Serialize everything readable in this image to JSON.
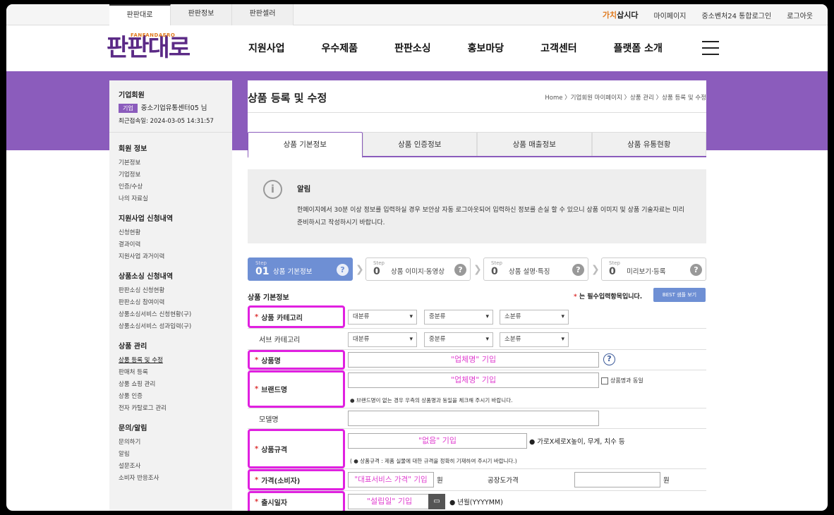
{
  "top_tabs": [
    "판판대로",
    "판판정보",
    "판판셀러"
  ],
  "top_links": {
    "gachi_a": "가치",
    "gachi_b": "삽시다",
    "mypage": "마이페이지",
    "sso": "중소벤처24 통합로그인",
    "logout": "로그아웃"
  },
  "logo": {
    "sub": "FANFANDAERO",
    "main": "판판대로"
  },
  "gnb": [
    "지원사업",
    "우수제품",
    "판판소싱",
    "홍보마당",
    "고객센터",
    "플랫폼 소개"
  ],
  "sidebar": {
    "member_title": "기업회원",
    "badge": "기업",
    "company": "중소기업유통센터05 님",
    "last_login": "최근접속일: 2024-03-05 14:31:57",
    "sections": [
      {
        "title": "회원 정보",
        "items": [
          "기본정보",
          "기업정보",
          "인증/수상",
          "나의 자료실"
        ]
      },
      {
        "title": "지원사업 신청내역",
        "items": [
          "신청현황",
          "결과이력",
          "지원사업 과거이력"
        ]
      },
      {
        "title": "상품소싱 신청내역",
        "items": [
          "판판소싱 신청현황",
          "판판소싱 참여이력",
          "상품소싱서비스 신청현황(구)",
          "상품소싱서비스 성과입력(구)"
        ]
      },
      {
        "title": "상품 관리",
        "items": [
          "상품 등록 및 수정",
          "판매처 등록",
          "상품 쇼핑 관리",
          "상품 인증",
          "전자 카탈로그 관리"
        ]
      },
      {
        "title": "문의/알림",
        "items": [
          "문의하기",
          "알림",
          "설문조사",
          "소비자 반응조사"
        ]
      }
    ]
  },
  "page": {
    "title": "상품 등록 및 수정",
    "breadcrumb": "Home 〉기업회원 마이페이지 〉상품 관리 〉상품 등록 및 수정"
  },
  "tabs": [
    "상품 기본정보",
    "상품 인증정보",
    "상품 매출정보",
    "상품 유통현황"
  ],
  "notice": {
    "title": "알림",
    "body": "한페이지에서 30분 이상 정보를 입력하실 경우 보안상 자동 로그아웃되어 입력하신 정보를 손실 할 수 있으니 상품 이미지 및 상품 기술자료는 미리 준비하시고 작성하시기 바랍니다."
  },
  "steps": [
    {
      "tag": "Step",
      "num": "01",
      "label": "상품 기본정보"
    },
    {
      "tag": "Step",
      "num": "0",
      "label": "상품 이미지·동영상"
    },
    {
      "tag": "Step",
      "num": "0",
      "label": "상품 설명·특징"
    },
    {
      "tag": "Step",
      "num": "0",
      "label": "미리보기·등록"
    }
  ],
  "form": {
    "section_title": "상품 기본정보",
    "required_mark": "*",
    "required_text": " 는 필수입력항목입니다.",
    "best_button": "BEST 샘플 보기",
    "category_label": "상품 카테고리",
    "sub_category_label": "서브 카테고리",
    "selects": [
      "대분류",
      "중분류",
      "소분류"
    ],
    "product_name_label": "상품명",
    "product_name_value": "\"업체명\" 기입",
    "brand_label": "브랜드명",
    "brand_value": "\"업체명\" 기입",
    "brand_same": "상품명과 동일",
    "brand_note": "● 브랜드명이 없는 경우 우측의 상품명과 동일을 체크해 주시기 바랍니다.",
    "model_label": "모델명",
    "spec_label": "상품규격",
    "spec_value": "\"없음\" 기입",
    "spec_hint": "● 가로X세로X높이, 무게, 치수 등",
    "spec_note": "( ● 상품규격 : 제품 실물에 대한 규격을 정확히 기재하여 주시기 바랍니다.)",
    "price_label": "가격(소비자)",
    "price_value": "\"대표서비스 가격\" 기입",
    "won": "원",
    "factory_label": "공장도가격",
    "release_label": "출시일자",
    "release_value": "\"설립일\" 기입",
    "release_hint": "● 년월(YYYYMM)"
  }
}
